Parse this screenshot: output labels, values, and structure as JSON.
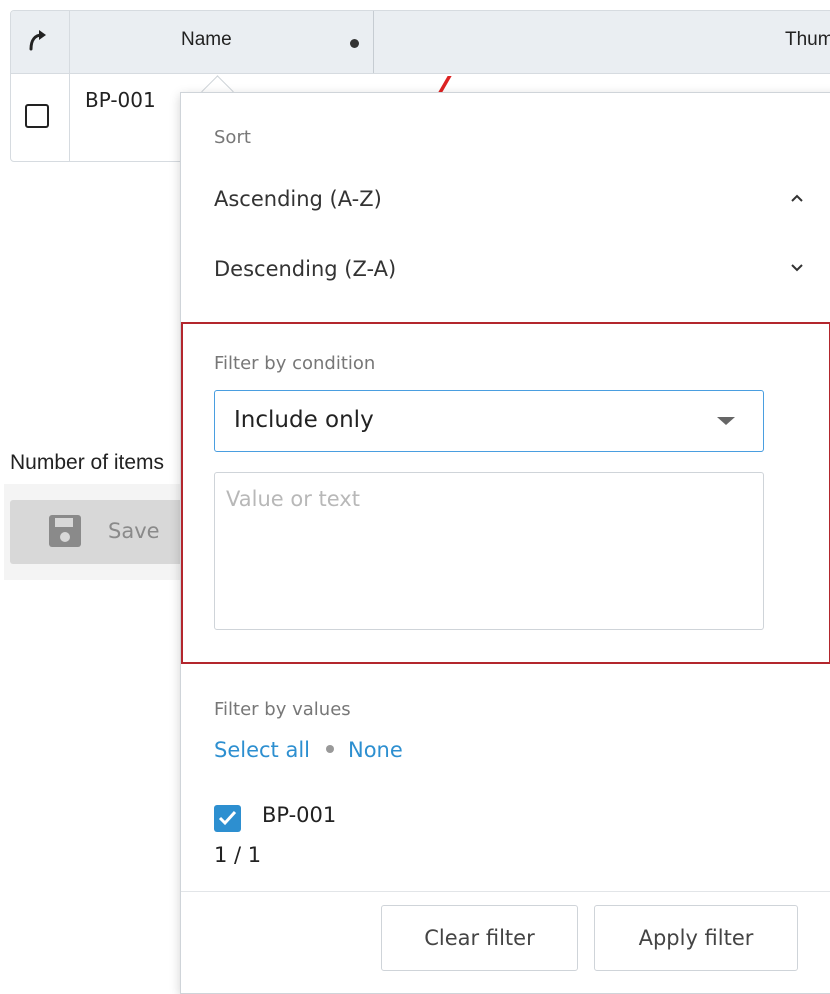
{
  "table": {
    "columns": {
      "name": "Name",
      "thumbnail": "Thumbnail"
    },
    "rows": [
      {
        "name": "BP-001"
      }
    ]
  },
  "page": {
    "items_label": "Number of items",
    "save_label": "Save"
  },
  "popup": {
    "sort": {
      "title": "Sort",
      "ascending": "Ascending (A-Z)",
      "descending": "Descending (Z-A)"
    },
    "filter_condition": {
      "title": "Filter by condition",
      "selected": "Include only",
      "value_placeholder": "Value or text"
    },
    "filter_values": {
      "title": "Filter by values",
      "select_all": "Select all",
      "none": "None",
      "items": [
        {
          "label": "BP-001",
          "checked": true
        }
      ],
      "count": "1 / 1"
    },
    "buttons": {
      "clear": "Clear filter",
      "apply": "Apply filter"
    }
  },
  "colors": {
    "accent": "#2d8fd0",
    "highlight_border": "#b3262d",
    "header_bg": "#eaeef2"
  }
}
